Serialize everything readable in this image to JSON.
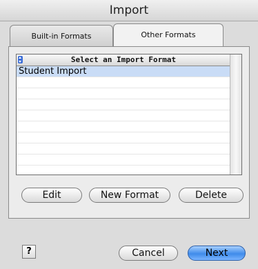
{
  "window": {
    "title": "Import"
  },
  "tabs": [
    {
      "label": "Built-in Formats",
      "active": false
    },
    {
      "label": "Other Formats",
      "active": true
    }
  ],
  "list": {
    "header": "Select an Import Format",
    "items": [
      {
        "label": "Student Import",
        "selected": true
      },
      {
        "label": "",
        "selected": false
      },
      {
        "label": "",
        "selected": false
      },
      {
        "label": "",
        "selected": false
      },
      {
        "label": "",
        "selected": false
      },
      {
        "label": "",
        "selected": false
      },
      {
        "label": "",
        "selected": false
      },
      {
        "label": "",
        "selected": false
      },
      {
        "label": "",
        "selected": false
      },
      {
        "label": "",
        "selected": false
      }
    ]
  },
  "actions": {
    "edit": "Edit",
    "new_format": "New Format",
    "delete": "Delete"
  },
  "footer": {
    "help": "?",
    "cancel": "Cancel",
    "next": "Next"
  },
  "colors": {
    "selection": "#c9dcf6",
    "primary_button": "#3f8bea"
  }
}
